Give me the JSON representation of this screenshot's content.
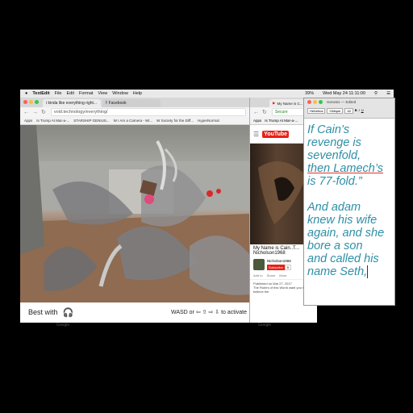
{
  "menubar": {
    "apple": "",
    "app": "TextEdit",
    "items": [
      "File",
      "Edit",
      "Format",
      "View",
      "Window",
      "Help"
    ],
    "battery": "39%",
    "clock": "Wed May 24  11:11:00"
  },
  "browser1": {
    "tabs": [
      {
        "label": "i kinda like everything right..."
      },
      {
        "label": "Facebook"
      }
    ],
    "url": "void.technology/everything/",
    "bookmarks": [
      "Apps",
      "Is Trump At Mar-a-...",
      "STARSHIP GENIUS...",
      "W I Am a Camera - Wi...",
      "W Society for the Diff...",
      "HyperNormal"
    ],
    "footer": {
      "best_with": "Best with",
      "controls": "WASD or ⇦ ⇧ ⇨ ⇩ to activate"
    },
    "bottom_label": "Google"
  },
  "youtube": {
    "tab": "My Name is C...",
    "url": "Secure",
    "bookmarks": [
      "Apps",
      "Is Trump At Mar-a-..."
    ],
    "logo": "YouTube",
    "title": "My Name is Cain..T...",
    "channel_header": "Nicholson1968",
    "channel": "Nicholson1968",
    "subscribe": "Subscribe",
    "count": "5",
    "actions": [
      "Add to",
      "Share",
      "More"
    ],
    "published": "Published on Mar 27, 2017",
    "description": "The Rulers of this World want you to believe the",
    "bottom_label": "Google"
  },
  "textedit": {
    "toolbar_title": "Genesis — Edited",
    "style": "Helvetica",
    "font_style": "Oblique",
    "size": "18",
    "lines": [
      "If Cain’s",
      "revenge is",
      "sevenfold,",
      "then Lamech’s",
      "is 77-fold.”",
      "",
      "And adam",
      "knew his wife",
      "again, and she",
      "bore a son",
      "and called his",
      "name Seth,"
    ]
  },
  "colors": {
    "text_teal": "#2e8fa6",
    "youtube_red": "#e62117"
  }
}
